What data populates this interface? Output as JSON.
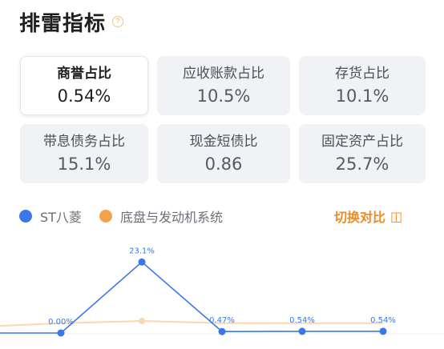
{
  "header": {
    "title": "排雷指标",
    "help_glyph": "?"
  },
  "cards": [
    {
      "label": "商誉占比",
      "value": "0.54%",
      "active": true
    },
    {
      "label": "应收账款占比",
      "value": "10.5%",
      "active": false
    },
    {
      "label": "存货占比",
      "value": "10.1%",
      "active": false
    },
    {
      "label": "带息债务占比",
      "value": "15.1%",
      "active": false
    },
    {
      "label": "现金短债比",
      "value": "0.86",
      "active": false
    },
    {
      "label": "固定资产占比",
      "value": "25.7%",
      "active": false
    }
  ],
  "legend": [
    {
      "name": "ST八菱",
      "color": "#3b78e7"
    },
    {
      "name": "底盘与发动机系统",
      "color": "#f5a34a"
    }
  ],
  "switch": {
    "label": "切换对比",
    "icon": "toggle-icon",
    "glyph": "◫"
  },
  "chart_data": {
    "type": "line",
    "series": [
      {
        "name": "ST八菱",
        "color": "#3b78e7",
        "values": [
          0.0,
          0.0,
          23.1,
          0.47,
          0.54,
          0.54
        ],
        "labels": [
          "",
          "0.00%",
          "23.1%",
          "0.47%",
          "0.54%",
          "0.54%"
        ]
      },
      {
        "name": "底盘与发动机系统",
        "color": "#f5a34a",
        "values": [
          2.0,
          3.2,
          3.9,
          3.2,
          3.2,
          3.2
        ]
      }
    ],
    "ylim": [
      0,
      25
    ]
  }
}
